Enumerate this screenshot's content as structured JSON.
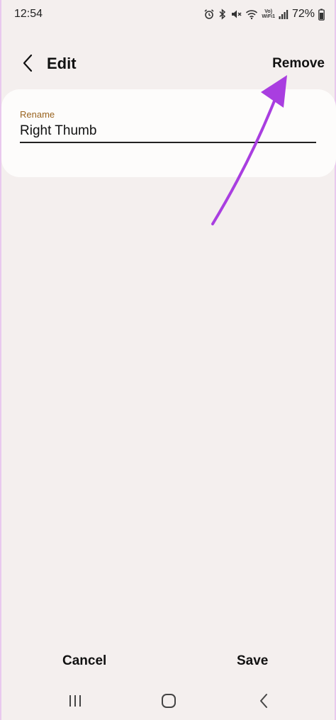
{
  "status_bar": {
    "time": "12:54",
    "network_label_top": "Vo)",
    "network_label_bottom": "WiFi1",
    "battery": "72%",
    "icons": [
      "alarm-icon",
      "bluetooth-icon",
      "mute-icon",
      "wifi-icon",
      "signal-icon",
      "battery-icon"
    ]
  },
  "app_bar": {
    "title": "Edit",
    "remove_label": "Remove"
  },
  "form": {
    "rename_label": "Rename",
    "rename_value": "Right Thumb"
  },
  "bottom_actions": {
    "cancel_label": "Cancel",
    "save_label": "Save"
  },
  "nav_bar": {
    "icons": [
      "recent-apps-icon",
      "home-icon",
      "back-icon"
    ]
  },
  "colors": {
    "background": "#f4efee",
    "card": "#fdfcfb",
    "label_accent": "#9a6420",
    "annotation_arrow": "#a93ee0"
  }
}
